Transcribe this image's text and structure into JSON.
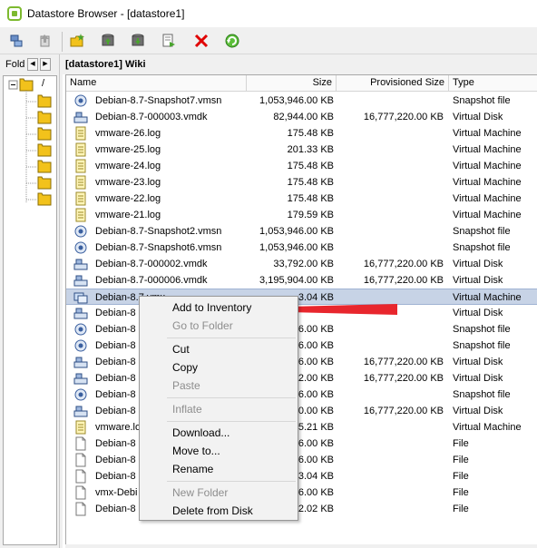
{
  "window": {
    "title": "Datastore Browser - [datastore1]",
    "accent_color": "#7dba2f"
  },
  "toolbar": {
    "buttons": [
      {
        "name": "browse-datastore-icon"
      },
      {
        "name": "upload-icon"
      },
      {
        "name": "new-folder-icon"
      },
      {
        "name": "upload-files-icon"
      },
      {
        "name": "download-icon"
      },
      {
        "name": "register-icon"
      },
      {
        "name": "delete-icon",
        "color": "#e00000"
      },
      {
        "name": "refresh-icon",
        "color": "#3aa33a"
      }
    ]
  },
  "left_pane": {
    "header_label": "Fold",
    "root_label": "/"
  },
  "breadcrumb": "[datastore1] Wiki",
  "columns": {
    "name": "Name",
    "size": "Size",
    "provisioned": "Provisioned Size",
    "type": "Type"
  },
  "rows": [
    {
      "name": "Debian-8.7-Snapshot7.vmsn",
      "size": "1,053,946.00 KB",
      "prov": "",
      "type": "Snapshot file",
      "icon": "snapshot-icon"
    },
    {
      "name": "Debian-8.7-000003.vmdk",
      "size": "82,944.00 KB",
      "prov": "16,777,220.00 KB",
      "type": "Virtual Disk",
      "icon": "disk-icon"
    },
    {
      "name": "vmware-26.log",
      "size": "175.48 KB",
      "prov": "",
      "type": "Virtual Machine",
      "icon": "log-icon"
    },
    {
      "name": "vmware-25.log",
      "size": "201.33 KB",
      "prov": "",
      "type": "Virtual Machine",
      "icon": "log-icon"
    },
    {
      "name": "vmware-24.log",
      "size": "175.48 KB",
      "prov": "",
      "type": "Virtual Machine",
      "icon": "log-icon"
    },
    {
      "name": "vmware-23.log",
      "size": "175.48 KB",
      "prov": "",
      "type": "Virtual Machine",
      "icon": "log-icon"
    },
    {
      "name": "vmware-22.log",
      "size": "175.48 KB",
      "prov": "",
      "type": "Virtual Machine",
      "icon": "log-icon"
    },
    {
      "name": "vmware-21.log",
      "size": "179.59 KB",
      "prov": "",
      "type": "Virtual Machine",
      "icon": "log-icon"
    },
    {
      "name": "Debian-8.7-Snapshot2.vmsn",
      "size": "1,053,946.00 KB",
      "prov": "",
      "type": "Snapshot file",
      "icon": "snapshot-icon"
    },
    {
      "name": "Debian-8.7-Snapshot6.vmsn",
      "size": "1,053,946.00 KB",
      "prov": "",
      "type": "Snapshot file",
      "icon": "snapshot-icon"
    },
    {
      "name": "Debian-8.7-000002.vmdk",
      "size": "33,792.00 KB",
      "prov": "16,777,220.00 KB",
      "type": "Virtual Disk",
      "icon": "disk-icon"
    },
    {
      "name": "Debian-8.7-000006.vmdk",
      "size": "3,195,904.00 KB",
      "prov": "16,777,220.00 KB",
      "type": "Virtual Disk",
      "icon": "disk-icon"
    },
    {
      "name": "Debian-8.7.vmx",
      "size": "3.04 KB",
      "prov": "",
      "type": "Virtual Machine",
      "icon": "vm-icon",
      "selected": true
    },
    {
      "name": "Debian-8",
      "size": "",
      "prov": "",
      "type": "Virtual Disk",
      "icon": "disk-icon"
    },
    {
      "name": "Debian-8",
      "size": "6.00 KB",
      "prov": "",
      "type": "Snapshot file",
      "icon": "snapshot-icon"
    },
    {
      "name": "Debian-8",
      "size": "6.00 KB",
      "prov": "",
      "type": "Snapshot file",
      "icon": "snapshot-icon"
    },
    {
      "name": "Debian-8",
      "size": "6.00 KB",
      "prov": "16,777,220.00 KB",
      "type": "Virtual Disk",
      "icon": "disk-icon"
    },
    {
      "name": "Debian-8",
      "size": "2.00 KB",
      "prov": "16,777,220.00 KB",
      "type": "Virtual Disk",
      "icon": "disk-icon"
    },
    {
      "name": "Debian-8",
      "size": "6.00 KB",
      "prov": "",
      "type": "Snapshot file",
      "icon": "snapshot-icon"
    },
    {
      "name": "Debian-8",
      "size": "0.00 KB",
      "prov": "16,777,220.00 KB",
      "type": "Virtual Disk",
      "icon": "disk-icon"
    },
    {
      "name": "vmware.lo",
      "size": "5.21 KB",
      "prov": "",
      "type": "Virtual Machine",
      "icon": "log-icon"
    },
    {
      "name": "Debian-8",
      "size": "6.00 KB",
      "prov": "",
      "type": "File",
      "icon": "file-icon"
    },
    {
      "name": "Debian-8",
      "size": "6.00 KB",
      "prov": "",
      "type": "File",
      "icon": "file-icon"
    },
    {
      "name": "Debian-8",
      "size": "3.04 KB",
      "prov": "",
      "type": "File",
      "icon": "file-icon"
    },
    {
      "name": "vmx-Debi",
      "size": "6.00 KB",
      "prov": "",
      "type": "File",
      "icon": "file-icon"
    },
    {
      "name": "Debian-8",
      "size": "2.02 KB",
      "prov": "",
      "type": "File",
      "icon": "file-icon"
    }
  ],
  "context_menu": {
    "items": [
      {
        "label": "Add to Inventory",
        "disabled": false
      },
      {
        "label": "Go to Folder",
        "disabled": true
      },
      {
        "label": "Cut",
        "disabled": false
      },
      {
        "label": "Copy",
        "disabled": false
      },
      {
        "label": "Paste",
        "disabled": true
      },
      {
        "label": "Inflate",
        "disabled": true
      },
      {
        "label": "Download...",
        "disabled": false
      },
      {
        "label": "Move to...",
        "disabled": false
      },
      {
        "label": "Rename",
        "disabled": false
      },
      {
        "label": "New Folder",
        "disabled": true
      },
      {
        "label": "Delete from Disk",
        "disabled": false
      }
    ]
  },
  "annotation": {
    "arrow_color": "#e8262d",
    "points_to": "Add to Inventory"
  }
}
